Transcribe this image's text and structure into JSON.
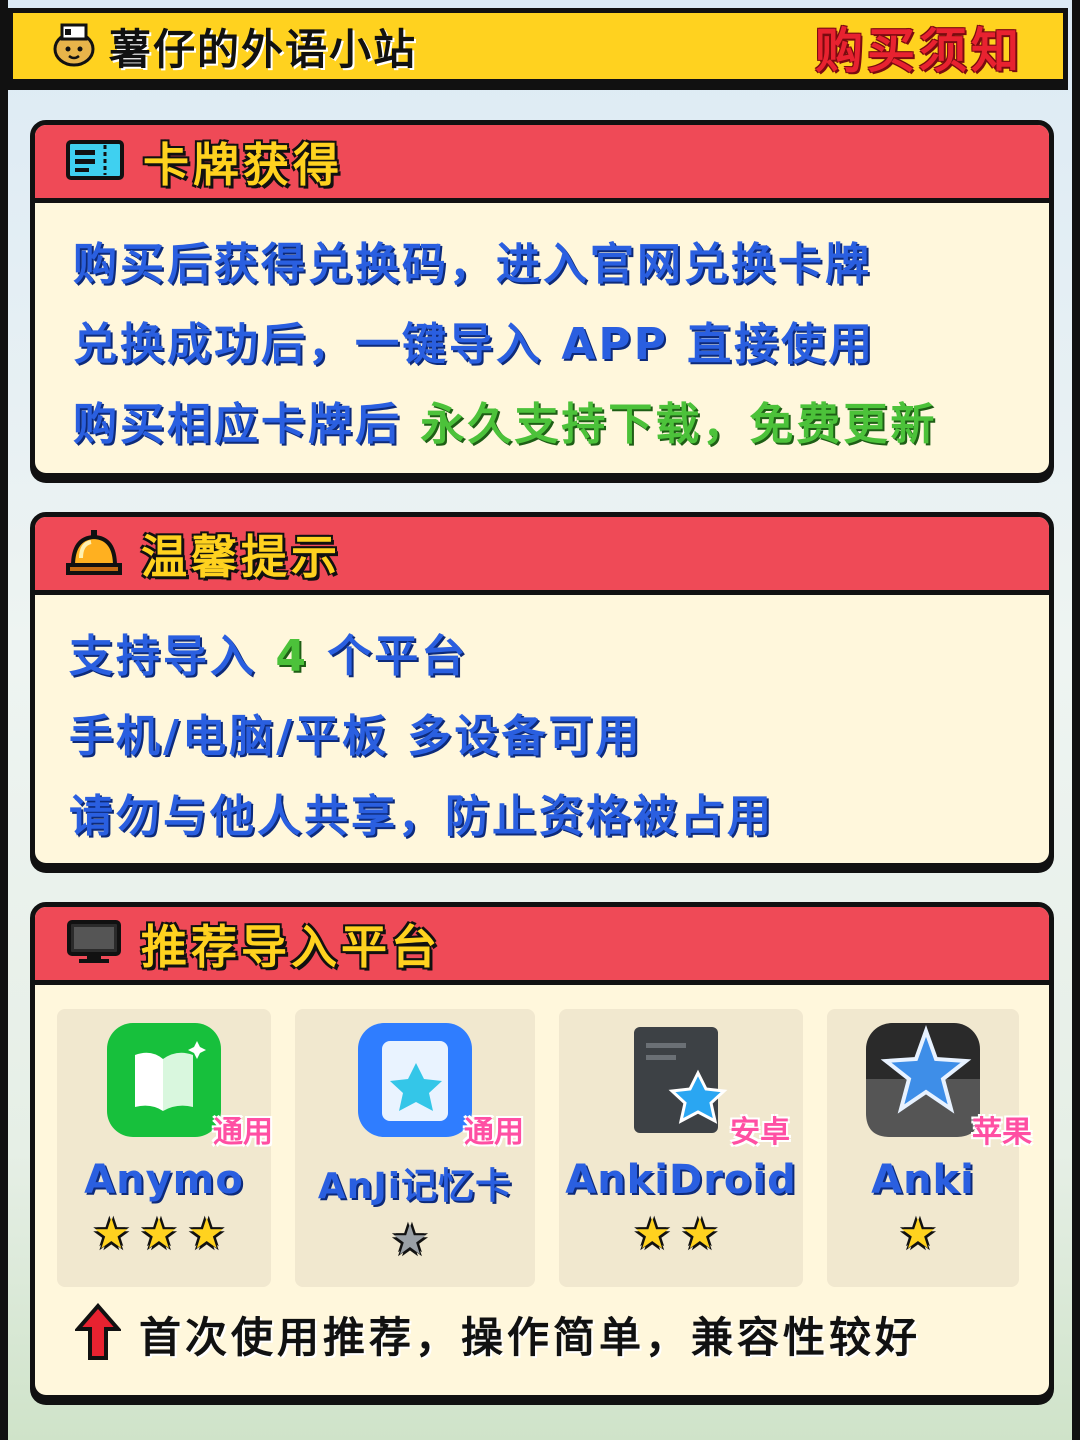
{
  "header": {
    "brand_title": "薯仔的外语小站",
    "notice_title": "购买须知"
  },
  "section_cards": {
    "title": "卡牌获得",
    "lines": [
      "购买后获得兑换码，进入官网兑换卡牌",
      "兑换成功后，一键导入 APP 直接使用"
    ],
    "line3_prefix": "购买相应卡牌后 ",
    "line3_highlight": "永久支持下载，免费更新"
  },
  "section_tips": {
    "title": "温馨提示",
    "line1_prefix": "支持导入 ",
    "line1_number": "4",
    "line1_suffix": " 个平台",
    "line2": "手机/电脑/平板  多设备可用",
    "line3": "请勿与他人共享，防止资格被占用"
  },
  "section_platforms": {
    "title": "推荐导入平台",
    "apps": [
      {
        "name": "Anymo",
        "badge": "通用",
        "stars": "★★★",
        "rating": 3,
        "icon": "anymo-icon",
        "color": "#17c03c"
      },
      {
        "name": "AnJi记忆卡",
        "badge": "通用",
        "stars": "★",
        "rating": 0,
        "icon": "anji-icon",
        "color": "#2f7dff"
      },
      {
        "name": "AnkiDroid",
        "badge": "安卓",
        "stars": "★★",
        "rating": 2,
        "icon": "ankidroid-icon",
        "color": "#3d4145"
      },
      {
        "name": "Anki",
        "badge": "苹果",
        "stars": "★",
        "rating": 1,
        "icon": "anki-icon",
        "color": "#2a2a2a"
      }
    ],
    "tip": "首次使用推荐，操作简单，兼容性较好"
  }
}
